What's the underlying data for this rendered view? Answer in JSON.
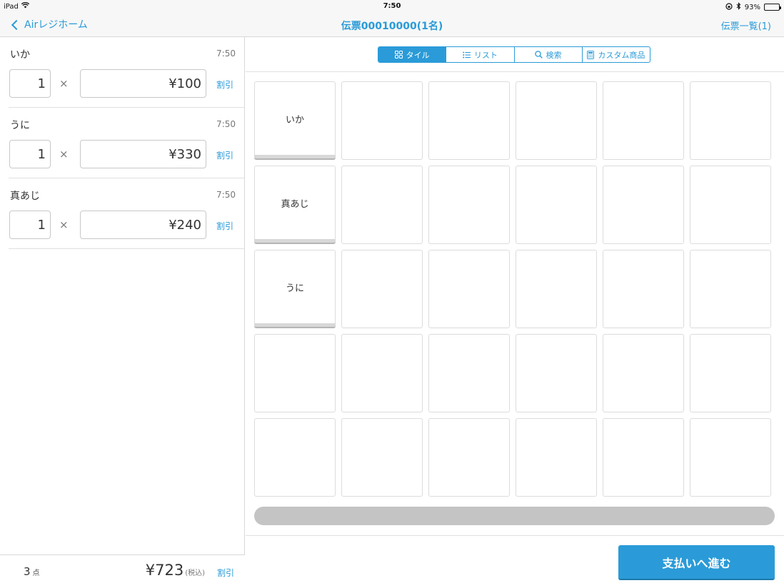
{
  "status_bar": {
    "device": "iPad",
    "time": "7:50",
    "battery": "93%",
    "battery_level": 0.93
  },
  "nav": {
    "back_label": "Airレジホーム",
    "title": "伝票00010000(1名)",
    "right_label": "伝票一覧(1)"
  },
  "order": {
    "items": [
      {
        "name": "いか",
        "time": "7:50",
        "qty": "1",
        "times": "×",
        "price": "¥100",
        "discount": "割引"
      },
      {
        "name": "うに",
        "time": "7:50",
        "qty": "1",
        "times": "×",
        "price": "¥330",
        "discount": "割引"
      },
      {
        "name": "真あじ",
        "time": "7:50",
        "qty": "1",
        "times": "×",
        "price": "¥240",
        "discount": "割引"
      }
    ],
    "footer": {
      "count": "3",
      "count_unit": "点",
      "total": "¥723",
      "tax_note": "(税込)",
      "discount": "割引"
    }
  },
  "segments": [
    {
      "label": "タイル",
      "icon": "tile-grid-icon",
      "active": true
    },
    {
      "label": "リスト",
      "icon": "list-icon",
      "active": false
    },
    {
      "label": "検索",
      "icon": "search-icon",
      "active": false
    },
    {
      "label": "カスタム商品",
      "icon": "calculator-icon",
      "active": false
    }
  ],
  "tiles": {
    "filled": [
      {
        "label": "いか"
      },
      {
        "label": "真あじ"
      },
      {
        "label": "うに"
      }
    ]
  },
  "pay_button": "支払いへ進む",
  "colors": {
    "accent": "#2a9bd8",
    "scrollbar": "#c4c4c4"
  }
}
